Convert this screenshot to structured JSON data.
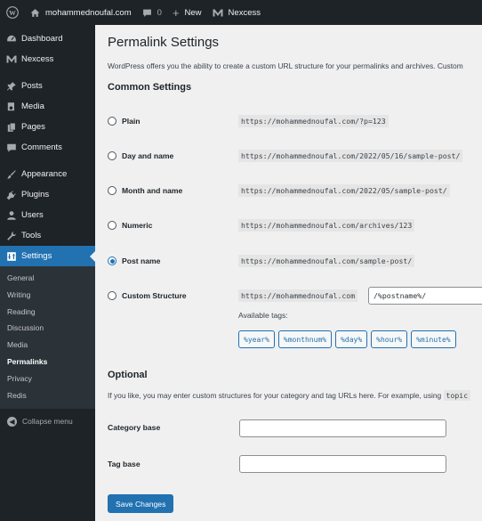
{
  "admin_bar": {
    "wp_logo_icon": "wordpress-logo-icon",
    "site_name": "mohammednoufal.com",
    "comments_count": "0",
    "new_label": "New",
    "nexcess_label": "Nexcess"
  },
  "sidebar": {
    "items": [
      {
        "label": "Dashboard",
        "icon": "dashboard-icon"
      },
      {
        "label": "Nexcess",
        "icon": "nexcess-icon"
      },
      {
        "label": "Posts",
        "icon": "pin-icon"
      },
      {
        "label": "Media",
        "icon": "media-icon"
      },
      {
        "label": "Pages",
        "icon": "pages-icon"
      },
      {
        "label": "Comments",
        "icon": "comment-icon"
      },
      {
        "label": "Appearance",
        "icon": "brush-icon"
      },
      {
        "label": "Plugins",
        "icon": "plug-icon"
      },
      {
        "label": "Users",
        "icon": "user-icon"
      },
      {
        "label": "Tools",
        "icon": "wrench-icon"
      },
      {
        "label": "Settings",
        "icon": "settings-icon"
      }
    ],
    "submenu": [
      "General",
      "Writing",
      "Reading",
      "Discussion",
      "Media",
      "Permalinks",
      "Privacy",
      "Redis"
    ],
    "collapse_label": "Collapse menu"
  },
  "page": {
    "title": "Permalink Settings",
    "intro": "WordPress offers you the ability to create a custom URL structure for your permalinks and archives. Custom",
    "common_heading": "Common Settings",
    "options": [
      {
        "label": "Plain",
        "example": "https://mohammednoufal.com/?p=123",
        "checked": false
      },
      {
        "label": "Day and name",
        "example": "https://mohammednoufal.com/2022/05/16/sample-post/",
        "checked": false
      },
      {
        "label": "Month and name",
        "example": "https://mohammednoufal.com/2022/05/sample-post/",
        "checked": false
      },
      {
        "label": "Numeric",
        "example": "https://mohammednoufal.com/archives/123",
        "checked": false
      },
      {
        "label": "Post name",
        "example": "https://mohammednoufal.com/sample-post/",
        "checked": true
      },
      {
        "label": "Custom Structure",
        "example": "https://mohammednoufal.com",
        "checked": false
      }
    ],
    "custom_structure_value": "/%postname%/",
    "available_tags_label": "Available tags:",
    "tags": [
      "%year%",
      "%monthnum%",
      "%day%",
      "%hour%",
      "%minute%"
    ],
    "optional_heading": "Optional",
    "optional_desc": "If you like, you may enter custom structures for your category and tag URLs here. For example, using",
    "optional_desc_code": "topic",
    "category_base_label": "Category base",
    "category_base_value": "",
    "tag_base_label": "Tag base",
    "tag_base_value": "",
    "save_label": "Save Changes"
  },
  "colors": {
    "accent": "#2271b1",
    "sidebar_bg": "#1d2327",
    "submenu_bg": "#2c3338",
    "page_bg": "#f0f0f1"
  }
}
